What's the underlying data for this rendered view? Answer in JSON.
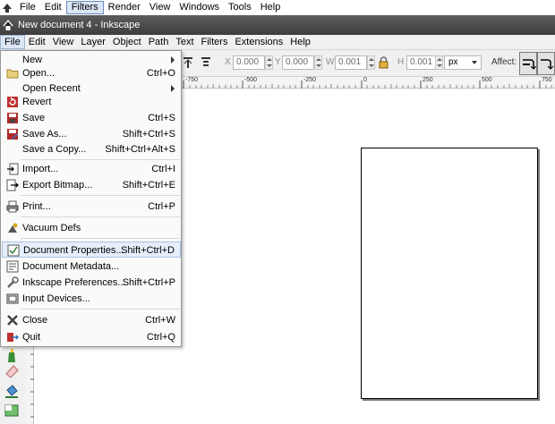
{
  "host_menu": [
    "File",
    "Edit",
    "Filters",
    "Render",
    "View",
    "Windows",
    "Tools",
    "Help"
  ],
  "window": {
    "title": "New document 4 - Inkscape"
  },
  "ink_menu": [
    "File",
    "Edit",
    "View",
    "Layer",
    "Object",
    "Path",
    "Text",
    "Filters",
    "Extensions",
    "Help"
  ],
  "controls": {
    "x_label": "X",
    "x_value": "0.000",
    "y_label": "Y",
    "y_value": "0.000",
    "w_label": "W",
    "w_value": "0.001",
    "h_label": "H",
    "h_value": "0.001",
    "unit": "px",
    "affect_label": "Affect:"
  },
  "ruler_labels": [
    "-750",
    "-500",
    "-250",
    "0",
    "250",
    "500",
    "750"
  ],
  "file_menu": {
    "items": [
      {
        "label": "New",
        "shortcut": "",
        "submenu": true,
        "icon": ""
      },
      {
        "label": "Open...",
        "shortcut": "Ctrl+O",
        "icon": "folder-icon"
      },
      {
        "label": "Open Recent",
        "shortcut": "",
        "submenu": true,
        "icon": ""
      },
      {
        "label": "Revert",
        "shortcut": "",
        "icon": "revert-icon"
      },
      {
        "label": "Save",
        "shortcut": "Ctrl+S",
        "icon": "save-icon"
      },
      {
        "label": "Save As...",
        "shortcut": "Shift+Ctrl+S",
        "icon": "save-as-icon"
      },
      {
        "label": "Save a Copy...",
        "shortcut": "Shift+Ctrl+Alt+S",
        "icon": ""
      },
      {
        "label": "Import...",
        "shortcut": "Ctrl+I",
        "icon": "import-icon"
      },
      {
        "label": "Export Bitmap...",
        "shortcut": "Shift+Ctrl+E",
        "icon": "export-icon"
      },
      {
        "label": "Print...",
        "shortcut": "Ctrl+P",
        "icon": "print-icon"
      },
      {
        "label": "Vacuum Defs",
        "shortcut": "",
        "icon": "vacuum-icon"
      },
      {
        "label": "Document Properties...",
        "shortcut": "Shift+Ctrl+D",
        "icon": "document-properties-icon",
        "highlighted": true
      },
      {
        "label": "Document Metadata...",
        "shortcut": "",
        "icon": "metadata-icon"
      },
      {
        "label": "Inkscape Preferences...",
        "shortcut": "Shift+Ctrl+P",
        "icon": "preferences-icon"
      },
      {
        "label": "Input Devices...",
        "shortcut": "",
        "icon": "input-devices-icon"
      },
      {
        "label": "Close",
        "shortcut": "Ctrl+W",
        "icon": "close-icon"
      },
      {
        "label": "Quit",
        "shortcut": "Ctrl+Q",
        "icon": "quit-icon"
      }
    ]
  }
}
